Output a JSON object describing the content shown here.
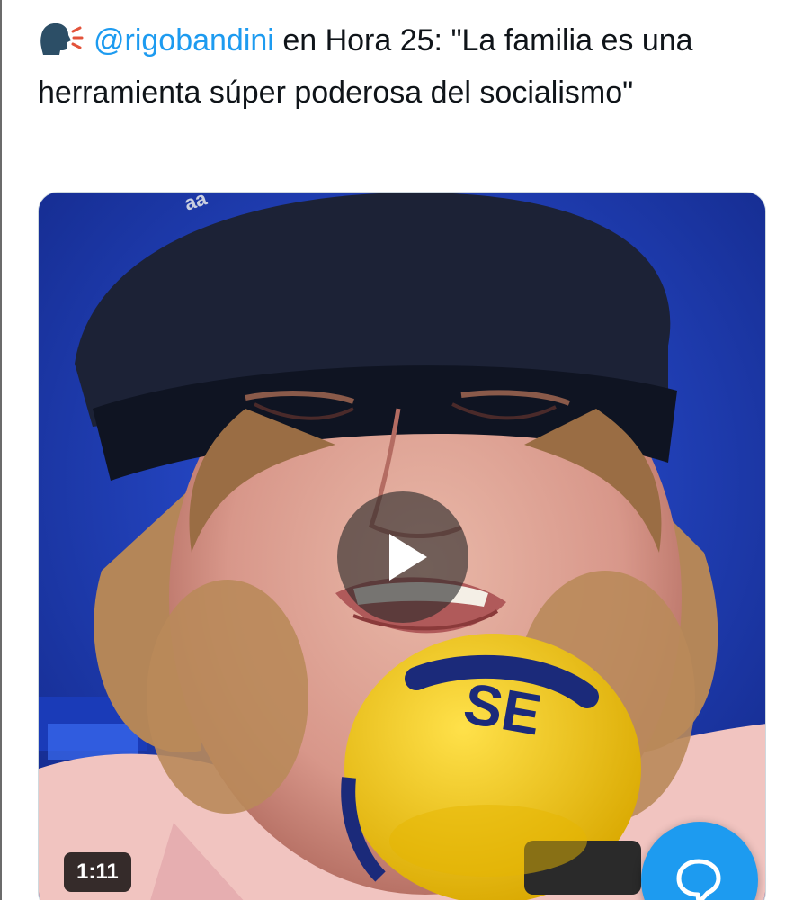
{
  "tweet": {
    "emoji_icon": "speaking-head-icon",
    "mention": "@rigobandini",
    "text_after_mention": " en Hora 25: \"La familia es una herramienta súper poderosa del socialismo\""
  },
  "media": {
    "play_icon": "play-icon",
    "duration": "1:11"
  },
  "fab": {
    "icon": "reply-bubble-icon"
  },
  "colors": {
    "link": "#1d9bf0",
    "text": "#0f1419",
    "studio_blue": "#1c35a8",
    "mic_yellow": "#f2c81b"
  }
}
